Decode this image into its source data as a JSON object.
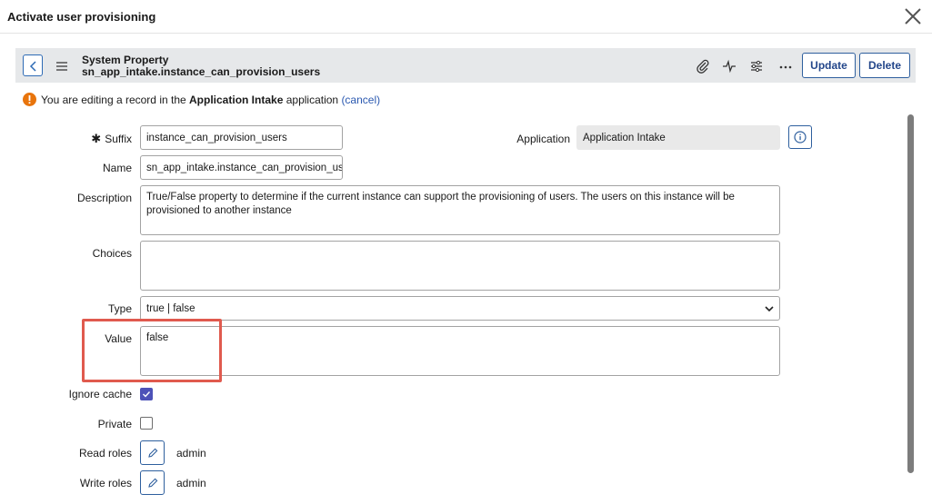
{
  "modal": {
    "title": "Activate user provisioning"
  },
  "header": {
    "record_type": "System Property",
    "record_name": "sn_app_intake.instance_can_provision_users",
    "update_label": "Update",
    "delete_label": "Delete",
    "icons": [
      "back-icon",
      "hamburger-icon",
      "paperclip-icon",
      "activity-icon",
      "sliders-icon",
      "more-icon"
    ]
  },
  "notice": {
    "prefix": "You are editing a record in the",
    "app_name": "Application Intake",
    "suffix": "application",
    "link": "(cancel)"
  },
  "form": {
    "suffix": {
      "label": "Suffix",
      "value": "instance_can_provision_users"
    },
    "application": {
      "label": "Application",
      "value": "Application Intake"
    },
    "name": {
      "label": "Name",
      "value": "sn_app_intake.instance_can_provision_us"
    },
    "description": {
      "label": "Description",
      "value": "True/False property to determine if the current instance can support the provisioning of users. The users on this instance will be provisioned to another instance"
    },
    "choices": {
      "label": "Choices",
      "value": ""
    },
    "type": {
      "label": "Type",
      "value": "true | false"
    },
    "value": {
      "label": "Value",
      "value": "false"
    },
    "ignore_cache": {
      "label": "Ignore cache",
      "checked": true
    },
    "private": {
      "label": "Private",
      "checked": false
    },
    "read_roles": {
      "label": "Read roles",
      "value": "admin"
    },
    "write_roles": {
      "label": "Write roles",
      "value": "admin"
    }
  },
  "colors": {
    "accent": "#2e5f9e",
    "checkbox": "#4d52b8",
    "highlight": "#e05a4e",
    "warning": "#e8740c"
  }
}
